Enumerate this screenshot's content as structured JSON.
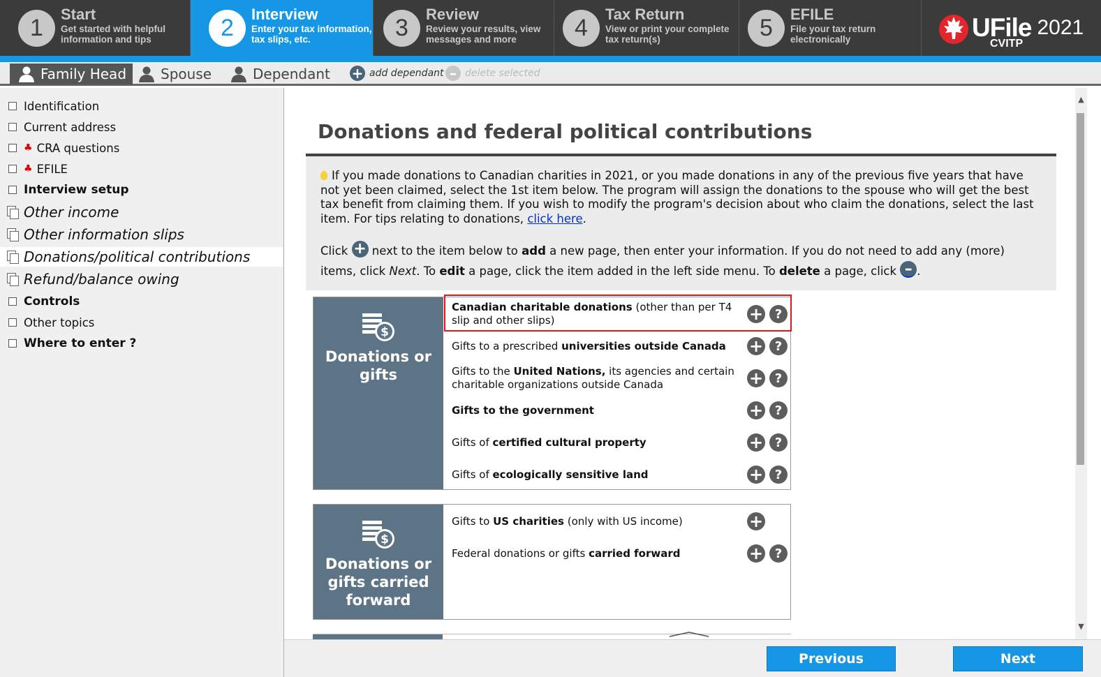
{
  "steps": [
    {
      "num": "1",
      "title": "Start",
      "desc1": "Get started with helpful",
      "desc2": "information and tips"
    },
    {
      "num": "2",
      "title": "Interview",
      "desc1": "Enter your tax information,",
      "desc2": "tax slips, etc."
    },
    {
      "num": "3",
      "title": "Review",
      "desc1": "Review your results, view",
      "desc2": "messages and more"
    },
    {
      "num": "4",
      "title": "Tax Return",
      "desc1": "View or print your complete",
      "desc2": "tax return(s)"
    },
    {
      "num": "5",
      "title": "EFILE",
      "desc1": "File your tax return",
      "desc2": "electronically"
    }
  ],
  "logo": {
    "brand": "UFile",
    "year": "2021",
    "sub": "CVITP"
  },
  "persons": {
    "family_head": "Family Head",
    "spouse": "Spouse",
    "dependant": "Dependant",
    "add": "add dependant",
    "delete": "delete selected"
  },
  "nav": [
    "Identification",
    "Current address",
    "CRA questions",
    "EFILE",
    "Interview setup",
    "Other income",
    "Other information slips",
    "Donations/political contributions",
    "Refund/balance owing",
    "Controls",
    "Other topics",
    "Where to enter ?"
  ],
  "main": {
    "title": "Donations and federal political contributions",
    "info1_a": "If you made donations to Canadian charities in 2021, or you made donations in any of the previous five years that have not yet been claimed, select the 1st item below. The program will assign the donations to the spouse who will get the best tax benefit from claiming them. If you wish to modify the program's decision about who claim the donations, select the last item. For tips relating to donations, ",
    "info1_link": "click here",
    "info1_end": ".",
    "info2": {
      "t1": "Click ",
      "t2": " next to the item below to ",
      "add": "add",
      "t3": " a new page, then enter your information. If you do not need to add any (more) items, click ",
      "next": "Next",
      "t4": ". To ",
      "edit": "edit",
      "t5": " a page, click the item added in the left side menu. To ",
      "delete": "delete",
      "t6": " a page, click ",
      "t7": "."
    }
  },
  "cat1": {
    "label_line1": "Donations or",
    "label_line2": "gifts",
    "rows": [
      {
        "a": "",
        "b": "Canadian charitable donations",
        "c": " (other than per T4 slip and other slips)"
      },
      {
        "a": "Gifts to a prescribed ",
        "b": "universities outside Canada",
        "c": ""
      },
      {
        "a": "Gifts to the ",
        "b": "United Nations,",
        "c": " its agencies and certain charitable organizations outside Canada"
      },
      {
        "a": "",
        "b": "Gifts to the government",
        "c": ""
      },
      {
        "a": "Gifts of ",
        "b": "certified cultural property",
        "c": ""
      },
      {
        "a": "Gifts of ",
        "b": "ecologically sensitive land",
        "c": ""
      }
    ]
  },
  "cat2": {
    "label_line1": "Donations or",
    "label_line2": "gifts carried",
    "label_line3": "forward",
    "rows": [
      {
        "a": "Gifts to ",
        "b": "US charities",
        "c": " (only with US income)"
      },
      {
        "a": "Federal donations or gifts ",
        "b": "carried forward",
        "c": ""
      }
    ]
  },
  "buttons": {
    "previous": "Previous",
    "next": "Next",
    "plus": "+",
    "help": "?"
  },
  "icons": {
    "step": "step-number",
    "person": "person-icon",
    "leaf": "maple-leaf-icon",
    "donation": "money-stack-icon"
  },
  "colors": {
    "accent": "#1597e5",
    "dark": "#3b3b3b",
    "category": "#5d7487",
    "highlight": "#e0161c"
  }
}
